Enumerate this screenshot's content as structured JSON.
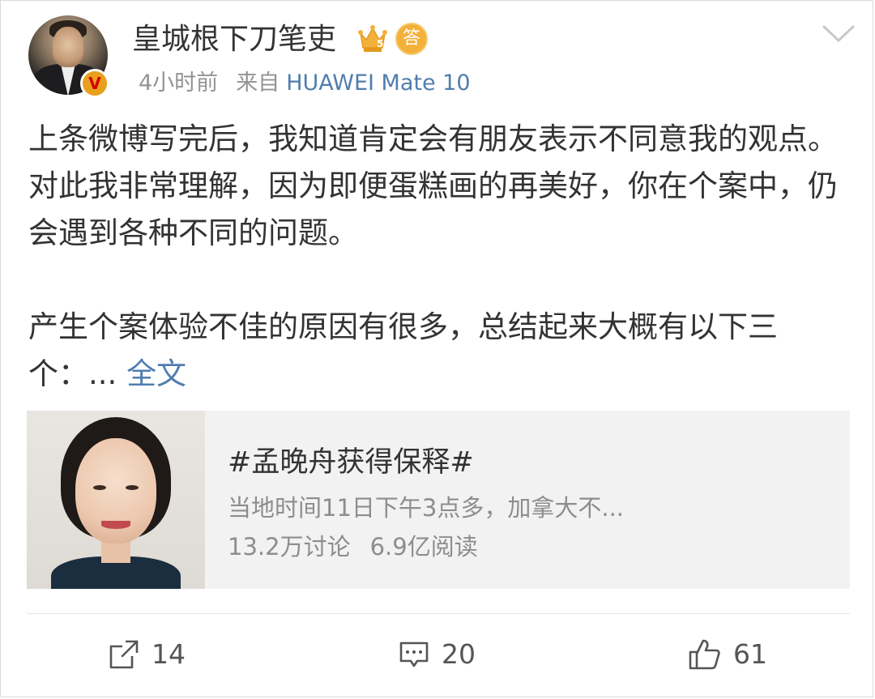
{
  "header": {
    "username": "皇城根下刀笔吏",
    "badges": [
      "crown-level-5-icon",
      "answer-badge-icon"
    ],
    "badge_answer_char": "答",
    "verified_char": "V",
    "time": "4小时前",
    "source_prefix": "来自",
    "source_device": "HUAWEI Mate 10",
    "more_icon": "chevron-down-icon"
  },
  "post": {
    "paragraph_1": "上条微博写完后，我知道肯定会有朋友表示不同意我的观点。对此我非常理解，因为即便蛋糕画的再美好，你在个案中，仍会遇到各种不同的问题。",
    "paragraph_2": "产生个案体验不佳的原因有很多，总结起来大概有以下三个：...",
    "full_text_link": "全文"
  },
  "topic_card": {
    "title": "#孟晚舟获得保释#",
    "description": "当地时间11日下午3点多，加拿大不...",
    "discussions": "13.2万讨论",
    "reads": "6.9亿阅读"
  },
  "actions": {
    "repost": {
      "icon": "share-icon",
      "count": "14"
    },
    "comment": {
      "icon": "comment-icon",
      "count": "20"
    },
    "like": {
      "icon": "thumbs-up-icon",
      "count": "61"
    }
  },
  "colors": {
    "link": "#507daf",
    "meta_gray": "#939393",
    "card_bg": "#f2f2f2",
    "verified_orange": "#f5a623"
  }
}
